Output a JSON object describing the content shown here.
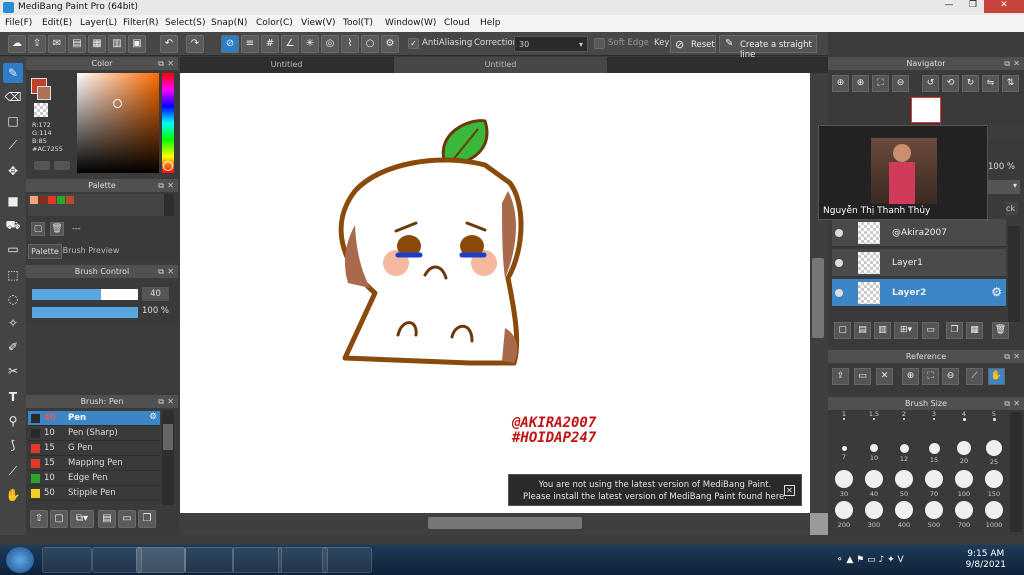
{
  "window": {
    "title": "MediBang Paint Pro (64bit)"
  },
  "menu": [
    "File(F)",
    "Edit(E)",
    "Layer(L)",
    "Filter(R)",
    "Select(S)",
    "Snap(N)",
    "Color(C)",
    "View(V)",
    "Tool(T)",
    "Window(W)",
    "Cloud",
    "Help"
  ],
  "toolbar": {
    "antialiasing_label": "AntiAliasing",
    "correction_label": "Correction",
    "correction_value": "30",
    "soft_edge_label": "Soft Edge",
    "key_label": "Key",
    "reset_label": "Reset",
    "straight_line_label": "Create a straight line"
  },
  "tabs": [
    "Untitled",
    "Untitled"
  ],
  "color_panel": {
    "title": "Color",
    "r": "R:172",
    "g": "G:114",
    "b": "B:85",
    "hex": "#AC7255",
    "primary": "#AC7255"
  },
  "palette_panel": {
    "title": "Palette",
    "tab_palette": "Palette",
    "tab_preview": "Brush Preview",
    "dash": "---",
    "swatches": [
      "#f5a57b",
      "#8b2b14",
      "#e23a2a",
      "#2aa52a",
      "#b54a2a"
    ]
  },
  "brush_control": {
    "title": "Brush Control",
    "size": "40",
    "opacity": "100 %"
  },
  "brush_list": {
    "title": "Brush: Pen",
    "items": [
      {
        "size": "40",
        "name": "Pen",
        "color": "#2a2a2a"
      },
      {
        "size": "10",
        "name": "Pen (Sharp)",
        "color": "#2a2a2a"
      },
      {
        "size": "15",
        "name": "G Pen",
        "color": "#e23a2a"
      },
      {
        "size": "15",
        "name": "Mapping Pen",
        "color": "#e23a2a"
      },
      {
        "size": "10",
        "name": "Edge Pen",
        "color": "#2aa52a"
      },
      {
        "size": "50",
        "name": "Stipple Pen",
        "color": "#f0d020"
      }
    ]
  },
  "canvas_text": {
    "line1": "@AKIRA2007",
    "line2": "#HOIDAP247"
  },
  "notice": {
    "line1": "You are not using the latest version of MediBang Paint.",
    "line2": "Please install the latest version of MediBang Paint found here."
  },
  "navigator": {
    "title": "Navigator",
    "zoom": "100 %"
  },
  "tooltip": {
    "caption": "Nguyễn Thị Thanh Thủy",
    "tail": "ck"
  },
  "layers": [
    {
      "name": "@Akira2007",
      "selected": false
    },
    {
      "name": "Layer1",
      "selected": false
    },
    {
      "name": "Layer2",
      "selected": true
    }
  ],
  "reference": {
    "title": "Reference"
  },
  "brush_size": {
    "title": "Brush Size",
    "row0": [
      "1",
      "1.5",
      "2",
      "3",
      "4",
      "5"
    ],
    "row1": [
      "7",
      "10",
      "12",
      "15",
      "20",
      "25"
    ],
    "row2": [
      "30",
      "40",
      "50",
      "70",
      "100",
      "150"
    ],
    "row3": [
      "200",
      "300",
      "400",
      "500",
      "700",
      "1000"
    ]
  },
  "taskbar": {
    "time": "9:15 AM",
    "date": "9/8/2021"
  }
}
